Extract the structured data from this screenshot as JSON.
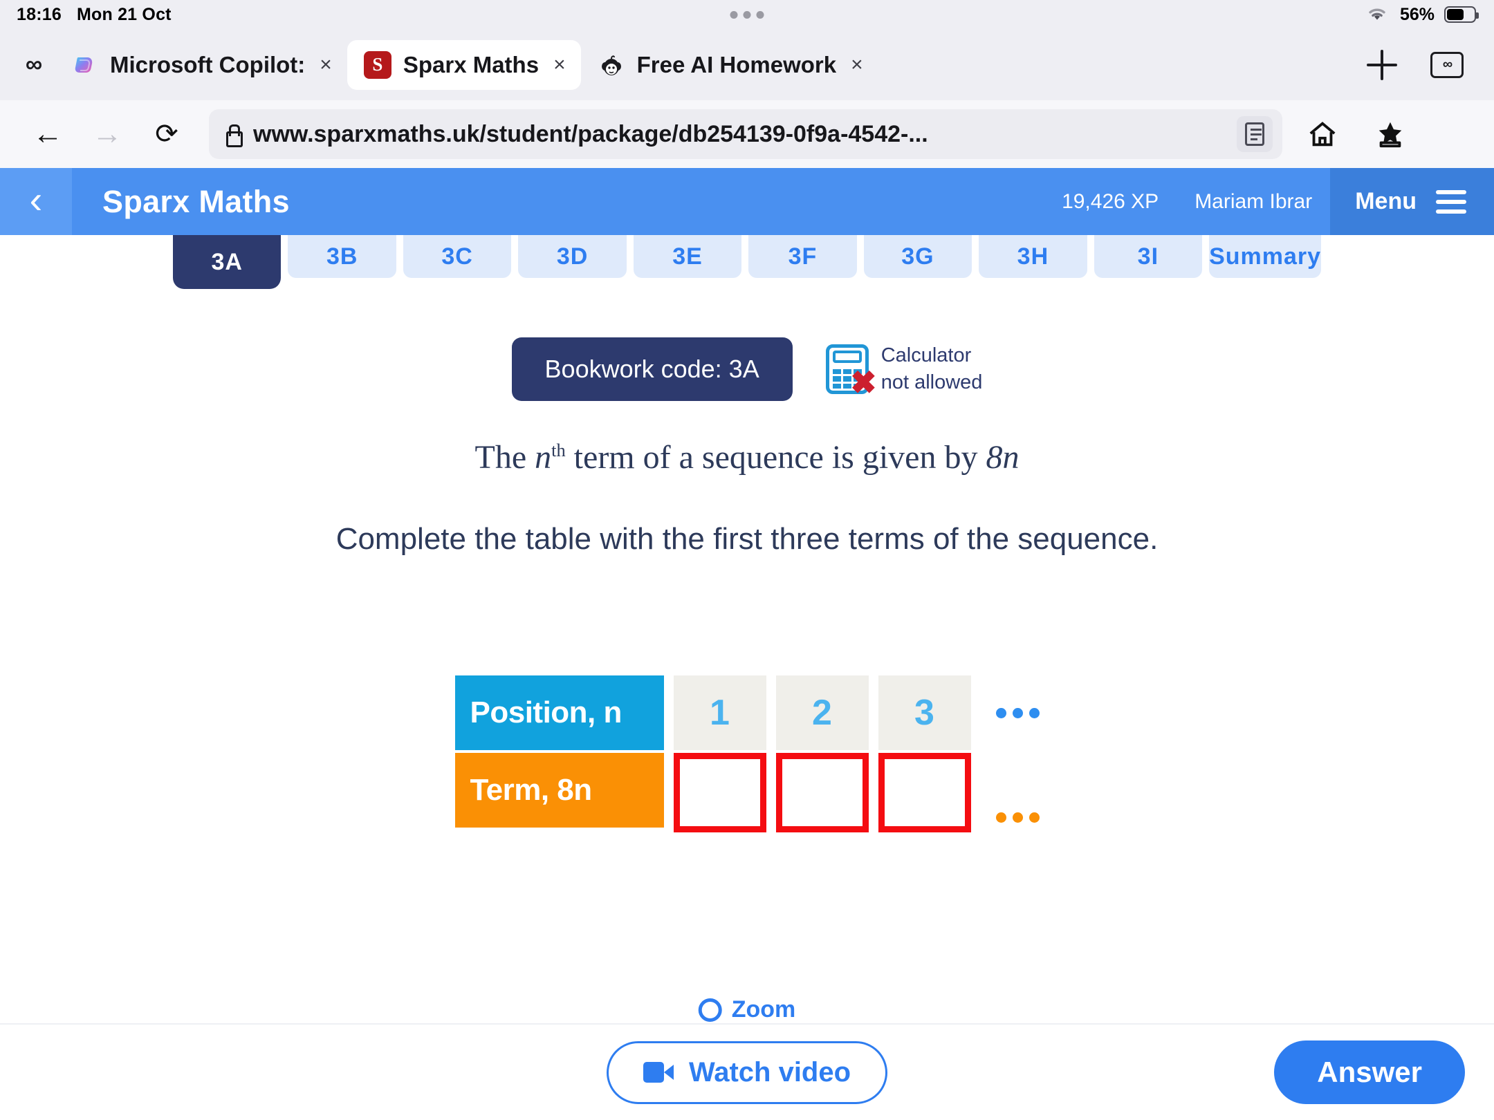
{
  "status_bar": {
    "time": "18:16",
    "date": "Mon 21 Oct",
    "battery_percent": "56%"
  },
  "browser": {
    "tabs": [
      {
        "title": "Microsoft Copilot:",
        "favicon": "copilot-icon",
        "close": "×",
        "active": false
      },
      {
        "title": "Sparx Maths",
        "favicon": "sparx-icon",
        "close": "×",
        "active": true
      },
      {
        "title": "Free AI Homework",
        "favicon": "monkey-icon",
        "close": "×",
        "active": false
      }
    ],
    "extension_icon": "infinity-icon",
    "new_tab_label": "+",
    "tab_overview_label": "∞",
    "nav": {
      "back": "←",
      "forward": "→",
      "reload": "⟳"
    },
    "url": "www.sparxmaths.uk/student/package/db254139-0f9a-4542-...",
    "toolbar_icons": [
      "reader-view-icon",
      "home-icon",
      "bookmarks-icon",
      "menu-icon"
    ]
  },
  "app_header": {
    "back_label": "‹",
    "title": "Sparx Maths",
    "xp": "19,426 XP",
    "user": "Mariam Ibrar",
    "menu_label": "Menu",
    "accent": "#4a90f0",
    "menu_bg": "#3b7fdb"
  },
  "task_tabs": [
    {
      "label": "3A",
      "active": true
    },
    {
      "label": "3B",
      "active": false
    },
    {
      "label": "3C",
      "active": false
    },
    {
      "label": "3D",
      "active": false
    },
    {
      "label": "3E",
      "active": false
    },
    {
      "label": "3F",
      "active": false
    },
    {
      "label": "3G",
      "active": false
    },
    {
      "label": "3H",
      "active": false
    },
    {
      "label": "3I",
      "active": false
    },
    {
      "label": "Summary",
      "active": false
    }
  ],
  "question": {
    "bookwork_code": "Bookwork code: 3A",
    "calculator_line1": "Calculator",
    "calculator_line2": "not allowed",
    "prompt_prefix": "The ",
    "prompt_var": "n",
    "prompt_sup": "th",
    "prompt_mid": " term of a sequence is given by ",
    "prompt_expr": "8n",
    "instruction": "Complete the table with the first three terms of the sequence.",
    "zoom_label": "Zoom"
  },
  "sequence_table": {
    "row_labels": [
      "Position, n",
      "Term, 8n"
    ],
    "positions": [
      "1",
      "2",
      "3"
    ],
    "terms": [
      "",
      "",
      ""
    ],
    "ellipsis": "…",
    "colors": {
      "position_bg": "#11a2dd",
      "term_bg": "#fa9005",
      "cell_bg": "#f0efea",
      "cell_text": "#4bb3ef",
      "input_border": "#f40d11"
    }
  },
  "bottom_bar": {
    "watch_video": "Watch video",
    "answer": "Answer"
  }
}
